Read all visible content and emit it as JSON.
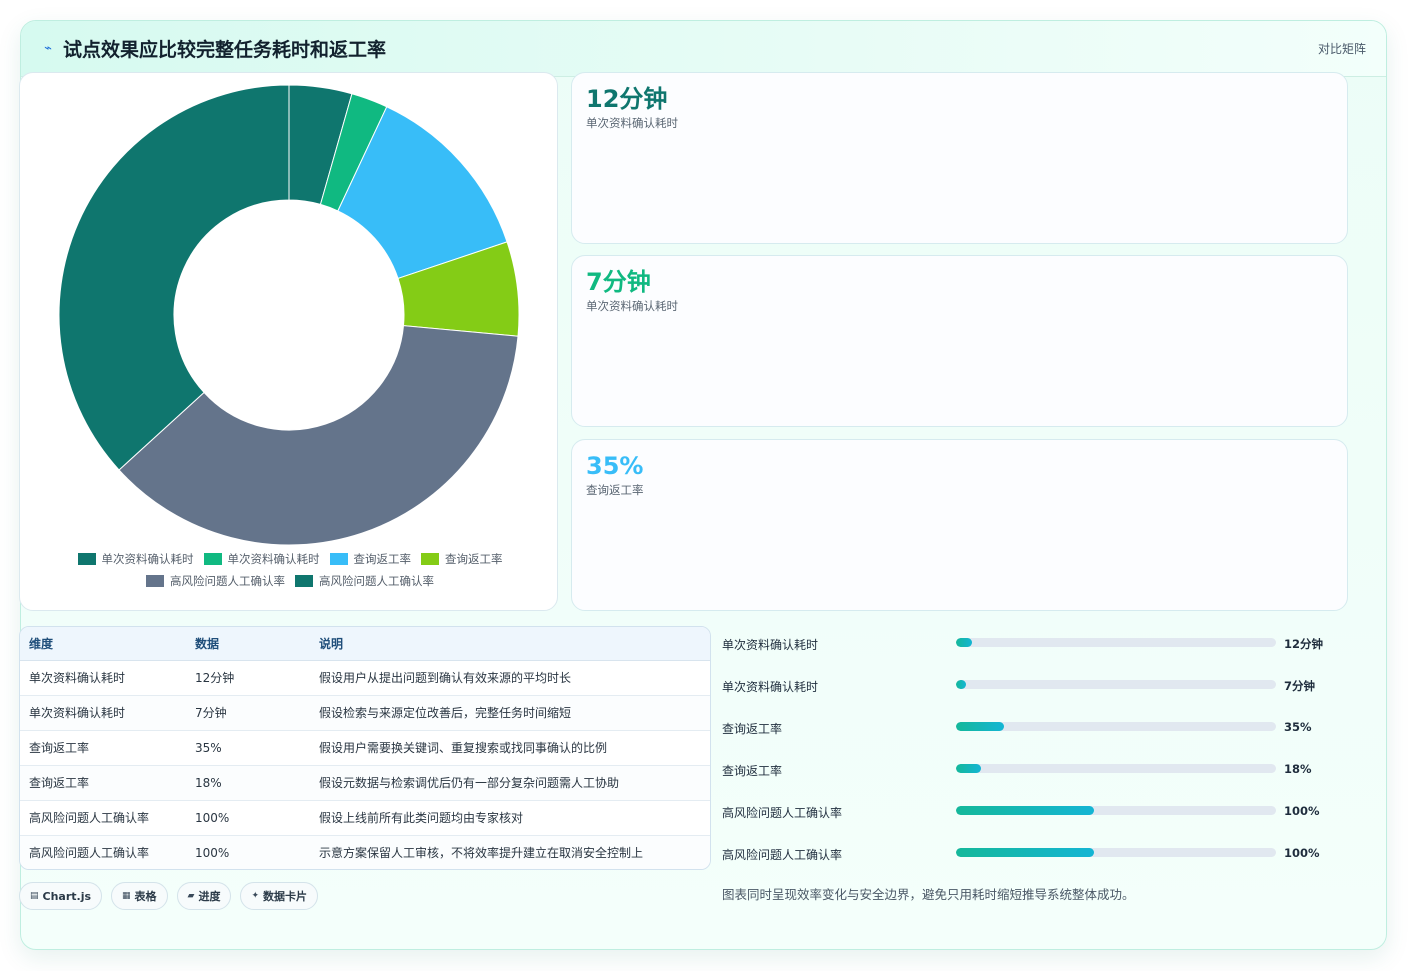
{
  "header": {
    "icon": "pulse-icon",
    "title": "试点效果应比较完整任务耗时和返工率",
    "right_label": "对比矩阵"
  },
  "chart_data": {
    "type": "pie",
    "donut": true,
    "categories": [
      "单次资料确认耗时",
      "单次资料确认耗时",
      "查询返工率",
      "查询返工率",
      "高风险问题人工确认率",
      "高风险问题人工确认率"
    ],
    "values": [
      12,
      7,
      35,
      18,
      100,
      100
    ],
    "colors": [
      "#0f766e",
      "#10b981",
      "#38bdf8",
      "#84cc16",
      "#64748b",
      "#0f766e"
    ],
    "legend_position": "bottom"
  },
  "stats": [
    {
      "value": "12分钟",
      "label": "单次资料确认耗时",
      "color": "#0f766e"
    },
    {
      "value": "7分钟",
      "label": "单次资料确认耗时",
      "color": "#10b981"
    },
    {
      "value": "35%",
      "label": "查询返工率",
      "color": "#38bdf8"
    }
  ],
  "table": {
    "headers": [
      "维度",
      "数据",
      "说明"
    ],
    "rows": [
      [
        "单次资料确认耗时",
        "12分钟",
        "假设用户从提出问题到确认有效来源的平均时长"
      ],
      [
        "单次资料确认耗时",
        "7分钟",
        "假设检索与来源定位改善后，完整任务时间缩短"
      ],
      [
        "查询返工率",
        "35%",
        "假设用户需要换关键词、重复搜索或找同事确认的比例"
      ],
      [
        "查询返工率",
        "18%",
        "假设元数据与检索调优后仍有一部分复杂问题需人工协助"
      ],
      [
        "高风险问题人工确认率",
        "100%",
        "假设上线前所有此类问题均由专家核对"
      ],
      [
        "高风险问题人工确认率",
        "100%",
        "示意方案保留人工审核，不将效率提升建立在取消安全控制上"
      ]
    ]
  },
  "tags": [
    {
      "icon": "chart-icon",
      "glyph": "▤",
      "label": "Chart.js"
    },
    {
      "icon": "table-icon",
      "glyph": "▦",
      "label": "表格"
    },
    {
      "icon": "progress-icon",
      "glyph": "▰",
      "label": "进度"
    },
    {
      "icon": "card-icon",
      "glyph": "✦",
      "label": "数据卡片"
    }
  ],
  "progress": [
    {
      "label": "单次资料确认耗时",
      "value": "12分钟",
      "fraction": 0.05
    },
    {
      "label": "单次资料确认耗时",
      "value": "7分钟",
      "fraction": 0.03
    },
    {
      "label": "查询返工率",
      "value": "35%",
      "fraction": 0.15
    },
    {
      "label": "查询返工率",
      "value": "18%",
      "fraction": 0.077
    },
    {
      "label": "高风险问题人工确认率",
      "value": "100%",
      "fraction": 0.43
    },
    {
      "label": "高风险问题人工确认率",
      "value": "100%",
      "fraction": 0.43
    }
  ],
  "note": "图表同时呈现效率变化与安全边界，避免只用耗时缩短推导系统整体成功。"
}
